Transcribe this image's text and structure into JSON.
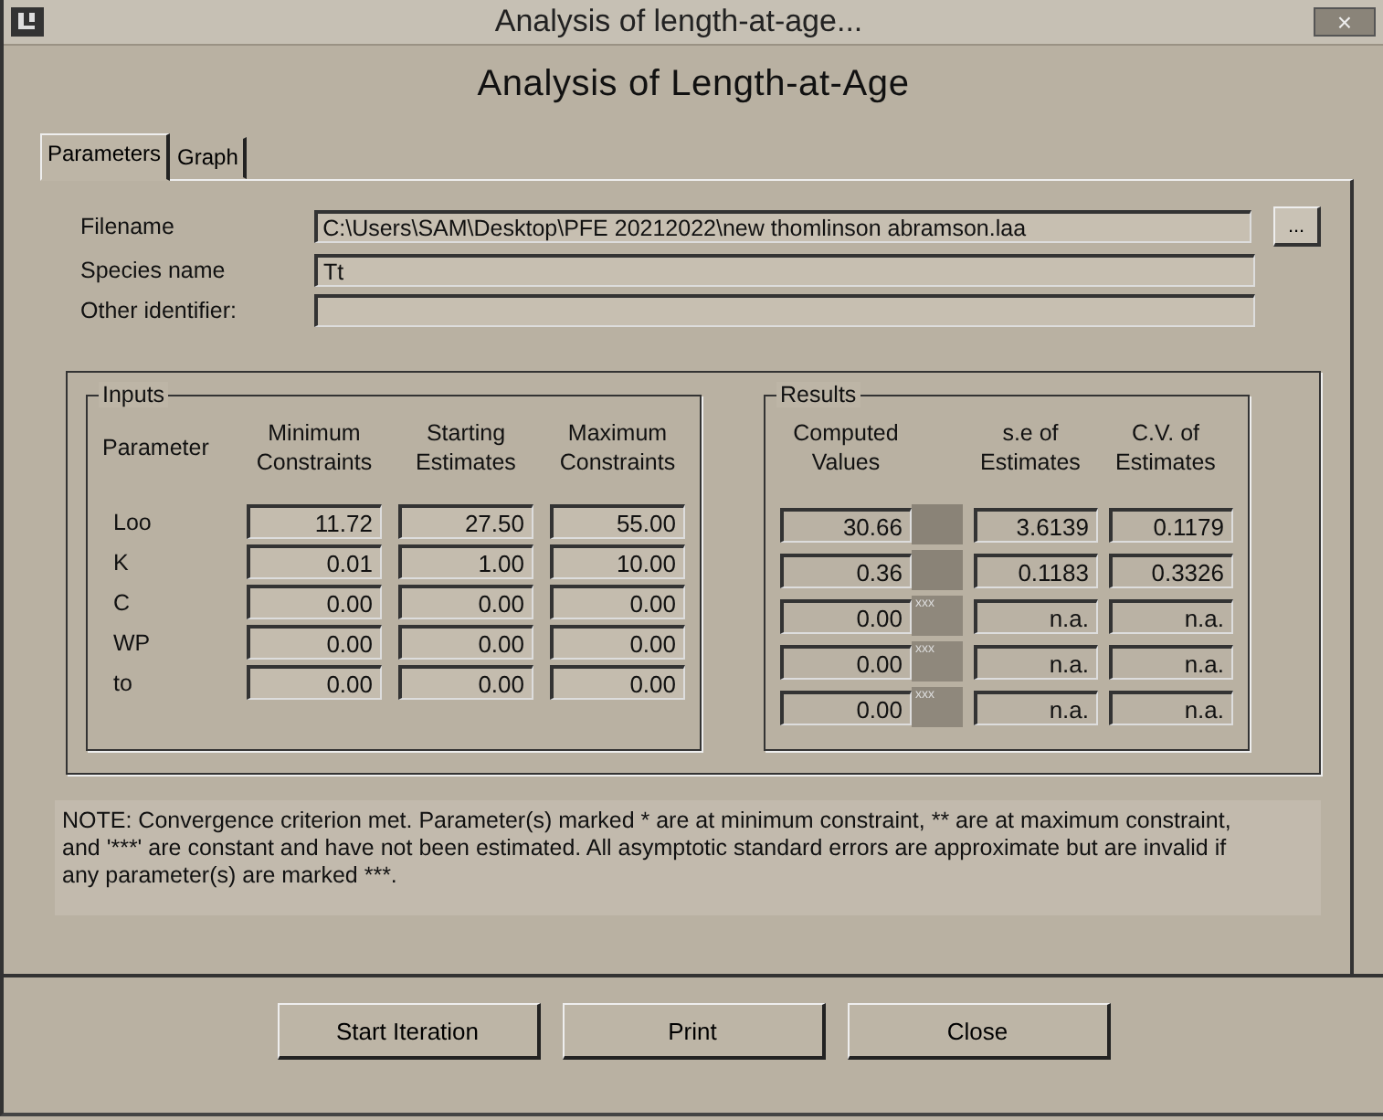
{
  "window": {
    "title": "Analysis of length-at-age...",
    "close_label": "×"
  },
  "heading": "Analysis of Length-at-Age",
  "tabs": [
    {
      "label": "Parameters",
      "selected": true
    },
    {
      "label": "Graph",
      "selected": false
    }
  ],
  "fields": [
    {
      "label": "Filename",
      "value": "C:\\Users\\SAM\\Desktop\\PFE 20212022\\new thomlinson abramson.laa",
      "browse": "..."
    },
    {
      "label": "Species name",
      "value": "Tt"
    },
    {
      "label": "Other identifier:"
    }
  ],
  "inputs": {
    "title": "Inputs",
    "columns": [
      "Parameter",
      "Minimum Constraints",
      "Starting Estimates",
      "Maximum Constraints"
    ],
    "rows": [
      {
        "parameter": "Loo",
        "min": "11.72",
        "start": "27.50",
        "max": "55.00"
      },
      {
        "parameter": "K",
        "min": "0.01",
        "start": "1.00",
        "max": "10.00"
      },
      {
        "parameter": "C",
        "min": "0.00",
        "start": "0.00",
        "max": "0.00"
      },
      {
        "parameter": "WP",
        "min": "0.00",
        "start": "0.00",
        "max": "0.00"
      },
      {
        "parameter": "to",
        "min": "0.00",
        "start": "0.00",
        "max": "0.00"
      }
    ]
  },
  "results": {
    "title": "Results",
    "columns": [
      "Computed Values",
      "s.e of Estimates",
      "C.V. of Estimates"
    ],
    "rows": [
      {
        "computed": "30.66",
        "se": "3.6139",
        "cv": "0.1179"
      },
      {
        "computed": "0.36",
        "se": "0.1183",
        "cv": "0.3326"
      },
      {
        "computed": "0.00",
        "flag": "xxx",
        "se": "n.a.",
        "cv": "n.a."
      },
      {
        "computed": "0.00",
        "flag": "xxx",
        "se": "n.a.",
        "cv": "n.a."
      },
      {
        "computed": "0.00",
        "flag": "xxx",
        "se": "n.a.",
        "cv": "n.a."
      }
    ]
  },
  "note": "NOTE: Convergence criterion met. Parameter(s) marked * are at minimum constraint, ** are at maximum constraint, and '***' are constant and have not been estimated. All asymptotic standard errors are approximate but are invalid if any parameter(s) are marked ***.",
  "buttons": [
    {
      "label": "Start Iteration"
    },
    {
      "label": "Print"
    },
    {
      "label": "Close"
    }
  ]
}
